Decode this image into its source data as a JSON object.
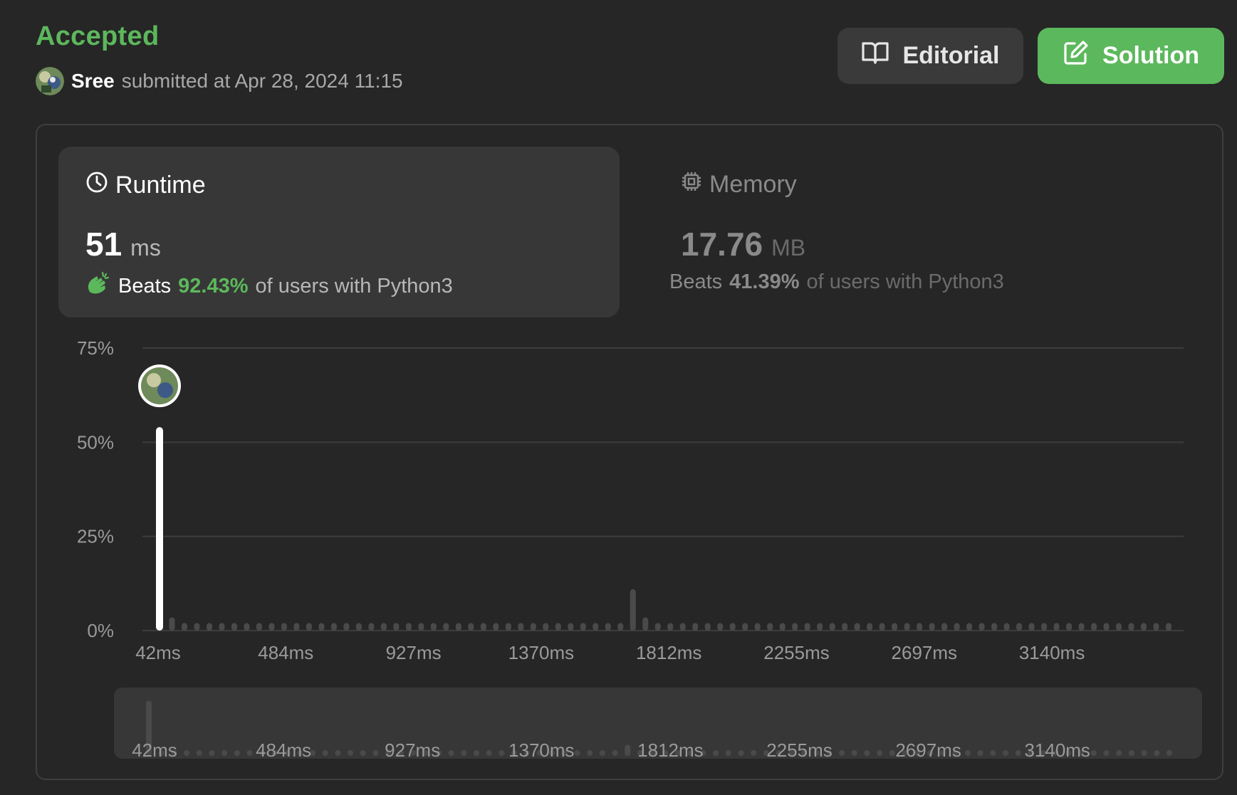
{
  "header": {
    "status": "Accepted",
    "user": "Sree",
    "submitted_text": "submitted at Apr 28, 2024 11:15"
  },
  "buttons": {
    "editorial": "Editorial",
    "solution": "Solution"
  },
  "runtime": {
    "title": "Runtime",
    "value": "51",
    "unit": "ms",
    "beats_label": "Beats",
    "beats_pct": "92.43%",
    "beats_rest": "of users with Python3"
  },
  "memory": {
    "title": "Memory",
    "value": "17.76",
    "unit": "MB",
    "beats_label": "Beats",
    "beats_pct": "41.39%",
    "beats_rest": "of users with Python3"
  },
  "icons": {
    "editorial": "book-open-icon",
    "solution": "edit-pencil-icon",
    "runtime": "clock-icon",
    "memory": "cpu-chip-icon",
    "beats": "clapping-hands-icon"
  },
  "colors": {
    "accent_green": "#5cb85c",
    "background": "#262626",
    "card": "#373737",
    "bar_highlight": "#ffffff",
    "bar": "#4a4a4a"
  },
  "chart_data": {
    "type": "bar",
    "y_ticks": [
      "75%",
      "50%",
      "25%",
      "0%"
    ],
    "ylim": [
      0,
      75
    ],
    "x_ticks": [
      "42ms",
      "484ms",
      "927ms",
      "1370ms",
      "1812ms",
      "2255ms",
      "2697ms",
      "3140ms"
    ],
    "x_start_ms": 42,
    "bin_ms": 55.3,
    "highlight_index": 0,
    "values": [
      54,
      3.5,
      2,
      2,
      2,
      2,
      2,
      2,
      2,
      2,
      2,
      2,
      2,
      2,
      2,
      2,
      2,
      2,
      2,
      2,
      2,
      2,
      2,
      2,
      2,
      2,
      2,
      2,
      2,
      2,
      2,
      2,
      2,
      2,
      2,
      2,
      2,
      2,
      11,
      3.5,
      2,
      2,
      2,
      2,
      2,
      2,
      2,
      2,
      2,
      2,
      2,
      2,
      2,
      2,
      2,
      2,
      2,
      2,
      2,
      2,
      2,
      2,
      2,
      2,
      2,
      2,
      2,
      2,
      2,
      2,
      2,
      2,
      2,
      2,
      2,
      2,
      2,
      2,
      2,
      2,
      2,
      2
    ],
    "grid": true
  }
}
